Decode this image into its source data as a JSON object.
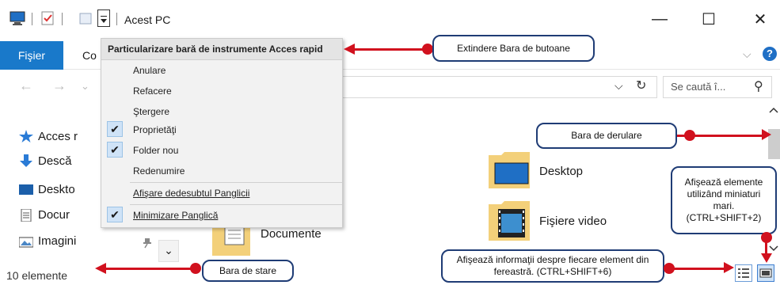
{
  "window": {
    "title": "Acest PC",
    "minimize": "—",
    "maximize": "☐",
    "close": "✕"
  },
  "qat_menu": {
    "header": "Particularizare bară de instrumente Acces rapid",
    "items": [
      {
        "label": "Anulare",
        "checked": false
      },
      {
        "label": "Refacere",
        "checked": false
      },
      {
        "label": "Ştergere",
        "checked": false
      },
      {
        "label": "Proprietăţi",
        "checked": true
      },
      {
        "label": "Folder nou",
        "checked": true
      },
      {
        "label": "Redenumire",
        "checked": false
      },
      {
        "label": "Afişare dedesubtul Panglicii",
        "checked": false
      },
      {
        "label": "Minimizare Panglică",
        "checked": true
      }
    ]
  },
  "ribbon": {
    "file_tab": "Fişier",
    "tab2": "Co",
    "help": "?",
    "chevron": "⌵"
  },
  "address_bar": {
    "back": "←",
    "forward": "→",
    "recent": "⌄",
    "dropdown": "⌵",
    "refresh": "↻",
    "search_placeholder": "Se caută î...",
    "search_icon": "⚲"
  },
  "nav_pane": {
    "items": [
      {
        "label": "Acces r"
      },
      {
        "label": "Descă"
      },
      {
        "label": "Deskto"
      },
      {
        "label": "Docur"
      },
      {
        "label": "Imagini"
      }
    ],
    "pin": "📌",
    "expand": "⌄"
  },
  "content": {
    "items": [
      {
        "label": "Desktop"
      },
      {
        "label": "Fişiere video"
      },
      {
        "label": "Documente"
      }
    ]
  },
  "status_bar": {
    "count": "10 elemente"
  },
  "callouts": {
    "qat": "Extindere Bara de butoane",
    "scroll": "Bara de derulare",
    "large_icons": "Afişează elemente utilizând miniaturi mari. (CTRL+SHIFT+2)",
    "details": "Afişează informaţii despre fiecare element din fereastră. (CTRL+SHIFT+6)",
    "status": "Bara de stare"
  },
  "colors": {
    "accent": "#1979ca",
    "callout_border": "#1f3c75",
    "arrow": "#d1111e"
  }
}
